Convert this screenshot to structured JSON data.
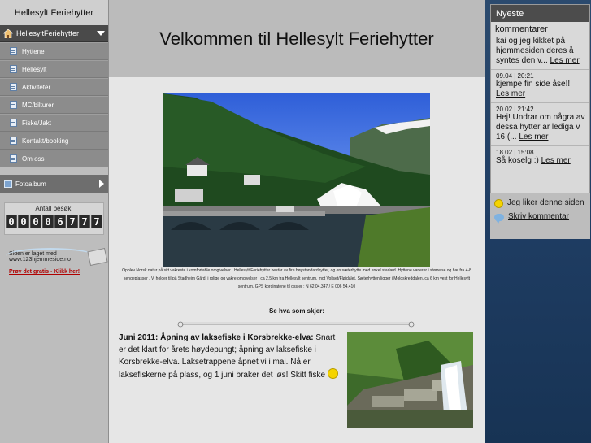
{
  "sidebar": {
    "site_title": "Hellesylt Feriehytter",
    "main_nav": "HellesyltFeriehytter",
    "items": [
      {
        "label": "Hyttene"
      },
      {
        "label": "Hellesylt"
      },
      {
        "label": "Aktiviteter"
      },
      {
        "label": "MC/bilturer"
      },
      {
        "label": "Fiske/Jakt"
      },
      {
        "label": "Kontakt/booking"
      },
      {
        "label": "Om oss"
      }
    ],
    "fotoalbum": "Fotoalbum",
    "counter_label": "Antall besøk:",
    "counter_digits": [
      "0",
      "0",
      "0",
      "0",
      "6",
      "7",
      "7",
      "7"
    ],
    "promo_line1": "Siden er laget med",
    "promo_line2": "www.123hjemmeside.no",
    "promo_link": "Prøv det gratis - Klikk her!"
  },
  "main": {
    "heading": "Velkommen til Hellesylt Feriehytter",
    "caption": "Opplev Norsk natur på sitt vakreste i komfortable omgivelser . Hellesylt Feriehytter består av fire høystandardhytter, og en sæterhytte med enkel stadard. Hyttene varierer i størrelse og har fra 4-8 sengeplasser . Vi holder til på Stadheim Gård, i rolige og vakre omgivelser , ca 2,5 km fra Hellesylt sentrum, mot Vollset/Fløjdalet. Sæterhytten ligger i Moldskreddalen, ca 6 km vest for Hellesylt sentrum. GPS kordinatene til oss er : N 62 04.347 / E 006 54.410",
    "subhead": "Se hva som skjer:",
    "news_lead": "Juni 2011: Åpning av laksefiske i Korsbrekke-elva:",
    "news_body": " Snart er det klart for årets høydepungt; åpning av laksefiske i Korsbrekke-elva. Laksetrappene åpnet vi i mai. Nå er laksefiskerne på plass, og 1 juni braker det løs! Skitt fiske"
  },
  "comments": {
    "header": "Nyeste",
    "overlay_title": "kommentarer",
    "items": [
      {
        "date": "",
        "text": "kai og jeg kikket på hjemmesiden deres å syntes den v...",
        "more": "Les mer"
      },
      {
        "date": "09.04 | 20:21",
        "text": "kjempe fin side åse!!",
        "more": "Les mer"
      },
      {
        "date": "20.02 | 21:42",
        "text": "Hej! Undrar om några av dessa hytter är lediga v 16 (...",
        "more": "Les mer"
      },
      {
        "date": "18.02 | 15:08",
        "text": "Så koselg :)",
        "more": "Les mer"
      }
    ],
    "like_link": "Jeg liker denne siden",
    "write_link": "Skriv kommentar"
  }
}
